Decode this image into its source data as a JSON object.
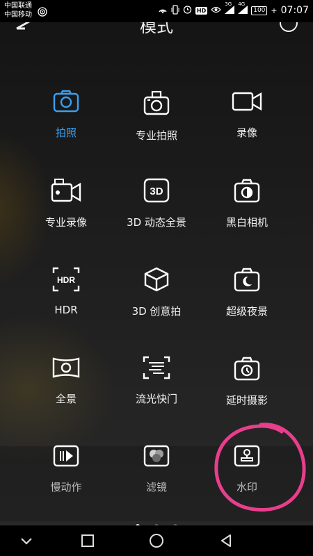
{
  "status_bar": {
    "carrier1": "中国联通",
    "carrier2": "中国移动",
    "hd": "HD",
    "signal1": "3G",
    "signal2": "4G",
    "battery": "100",
    "charge": "+",
    "time": "07:07"
  },
  "header": {
    "title": "模式"
  },
  "modes": [
    {
      "label": "拍照",
      "icon": "camera-icon"
    },
    {
      "label": "专业拍照",
      "icon": "pro-camera-icon"
    },
    {
      "label": "录像",
      "icon": "video-camera-icon"
    },
    {
      "label": "专业录像",
      "icon": "pro-video-icon"
    },
    {
      "label": "3D 动态全景",
      "icon": "3d-panorama-icon"
    },
    {
      "label": "黑白相机",
      "icon": "monochrome-icon"
    },
    {
      "label": "HDR",
      "icon": "hdr-icon"
    },
    {
      "label": "3D 创意拍",
      "icon": "3d-cube-icon"
    },
    {
      "label": "超级夜景",
      "icon": "night-mode-icon"
    },
    {
      "label": "全景",
      "icon": "panorama-icon"
    },
    {
      "label": "流光快门",
      "icon": "light-painting-icon"
    },
    {
      "label": "延时摄影",
      "icon": "time-lapse-icon"
    },
    {
      "label": "慢动作",
      "icon": "slow-motion-icon"
    },
    {
      "label": "滤镜",
      "icon": "filter-icon"
    },
    {
      "label": "水印",
      "icon": "watermark-icon"
    }
  ],
  "icon_glyphs": {
    "3d": "3D",
    "hdr": "HDR"
  },
  "colors": {
    "accent": "#3aa0f0",
    "annotation": "#e83e8c"
  }
}
